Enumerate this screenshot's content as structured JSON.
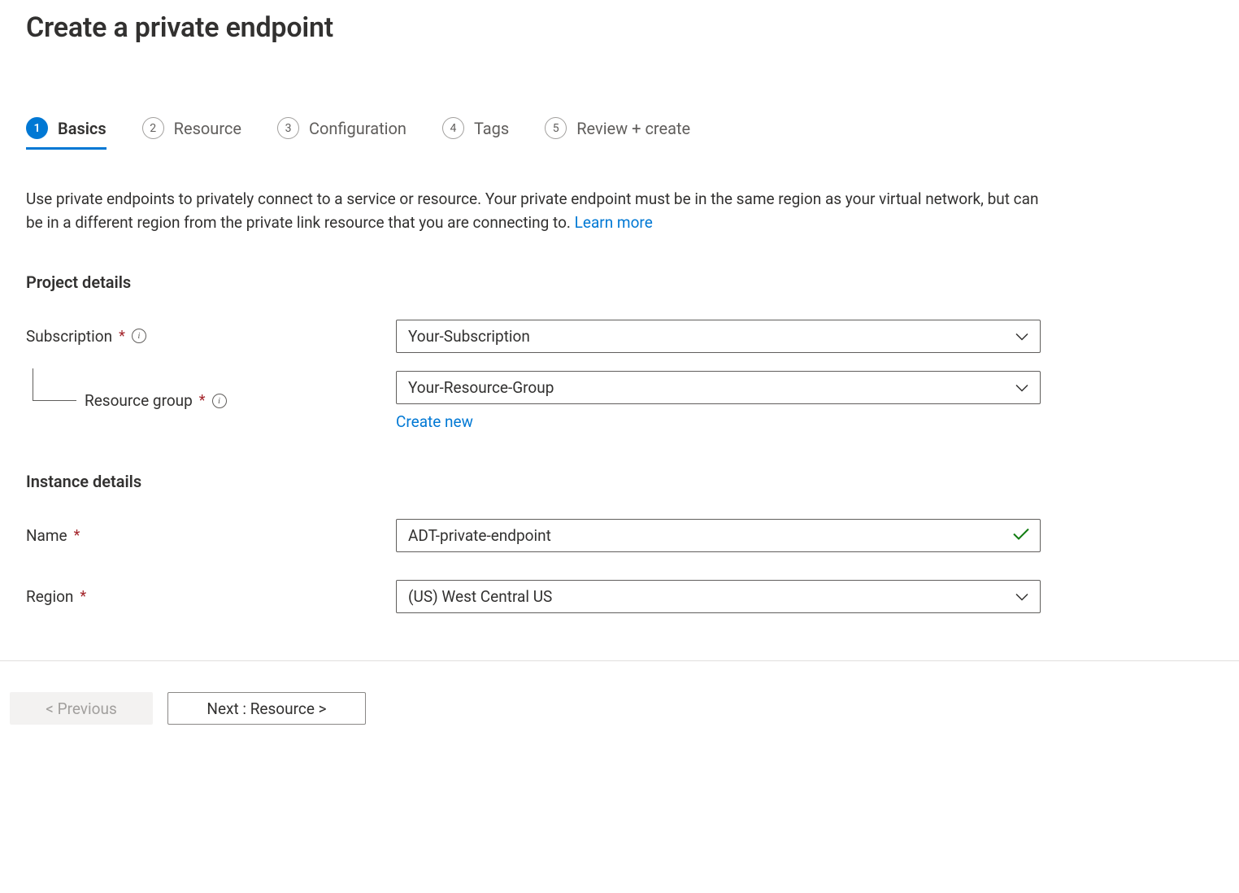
{
  "page_title": "Create a private endpoint",
  "tabs": [
    {
      "num": "1",
      "label": "Basics"
    },
    {
      "num": "2",
      "label": "Resource"
    },
    {
      "num": "3",
      "label": "Configuration"
    },
    {
      "num": "4",
      "label": "Tags"
    },
    {
      "num": "5",
      "label": "Review + create"
    }
  ],
  "description_text": "Use private endpoints to privately connect to a service or resource. Your private endpoint must be in the same region as your virtual network, but can be in a different region from the private link resource that you are connecting to.  ",
  "learn_more": "Learn more",
  "section1": "Project details",
  "section2": "Instance details",
  "form": {
    "subscription": {
      "label": "Subscription",
      "value": "Your-Subscription"
    },
    "resource_group": {
      "label": "Resource group",
      "value": "Your-Resource-Group"
    },
    "create_new": "Create new",
    "name": {
      "label": "Name",
      "value": "ADT-private-endpoint"
    },
    "region": {
      "label": "Region",
      "value": "(US) West Central US"
    }
  },
  "footer": {
    "previous": "< Previous",
    "next": "Next : Resource >"
  }
}
